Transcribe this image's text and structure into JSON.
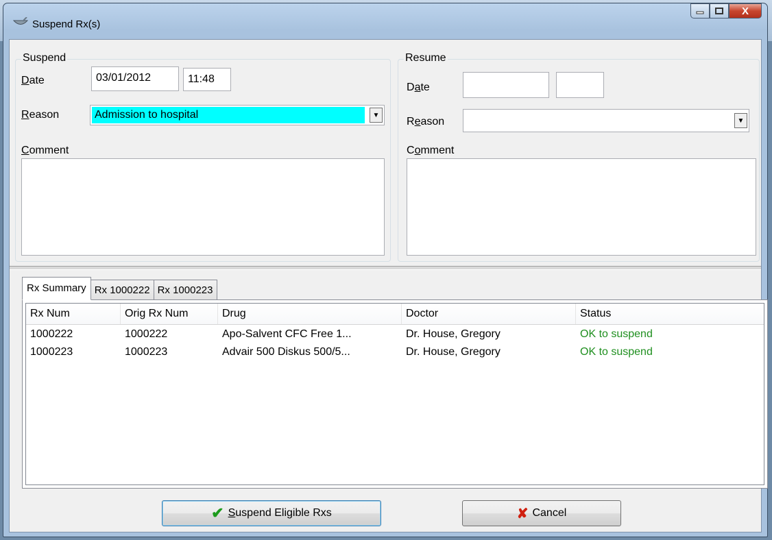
{
  "window": {
    "title": "Suspend Rx(s)",
    "buttons": {
      "minimize": "–",
      "maximize": "□",
      "close": "X"
    }
  },
  "suspend": {
    "group_label": "Suspend",
    "date_label_u": "D",
    "date_label_rest": "ate",
    "date_value": "03/01/2012",
    "time_value": "11:48",
    "reason_label_u": "R",
    "reason_label_rest": "eason",
    "reason_value": "Admission to hospital",
    "comment_label_u": "C",
    "comment_label_rest": "omment",
    "comment_value": ""
  },
  "resume": {
    "group_label": "Resume",
    "date_label_pre": "D",
    "date_label_u": "a",
    "date_label_rest": "te",
    "date_value": "",
    "time_value": "",
    "reason_label_pre": "R",
    "reason_label_u": "e",
    "reason_label_rest": "ason",
    "reason_value": "",
    "comment_label_pre": "C",
    "comment_label_u": "o",
    "comment_label_rest": "mment",
    "comment_value": ""
  },
  "tabs": [
    "Rx Summary",
    "Rx 1000222",
    "Rx 1000223"
  ],
  "table": {
    "columns": [
      "Rx Num",
      "Orig Rx Num",
      "Drug",
      "Doctor",
      "Status"
    ],
    "rows": [
      [
        "1000222",
        "1000222",
        "Apo-Salvent CFC Free 1...",
        "Dr. House, Gregory",
        "OK to suspend"
      ],
      [
        "1000223",
        "1000223",
        "Advair 500 Diskus 500/5...",
        "Dr. House, Gregory",
        "OK to suspend"
      ]
    ]
  },
  "footer": {
    "suspend_u": "S",
    "suspend_rest": "uspend Eligible Rxs",
    "cancel_label": "Cancel"
  },
  "colors": {
    "selection_highlight": "#00ffff",
    "status_ok": "#1f8f1f"
  }
}
